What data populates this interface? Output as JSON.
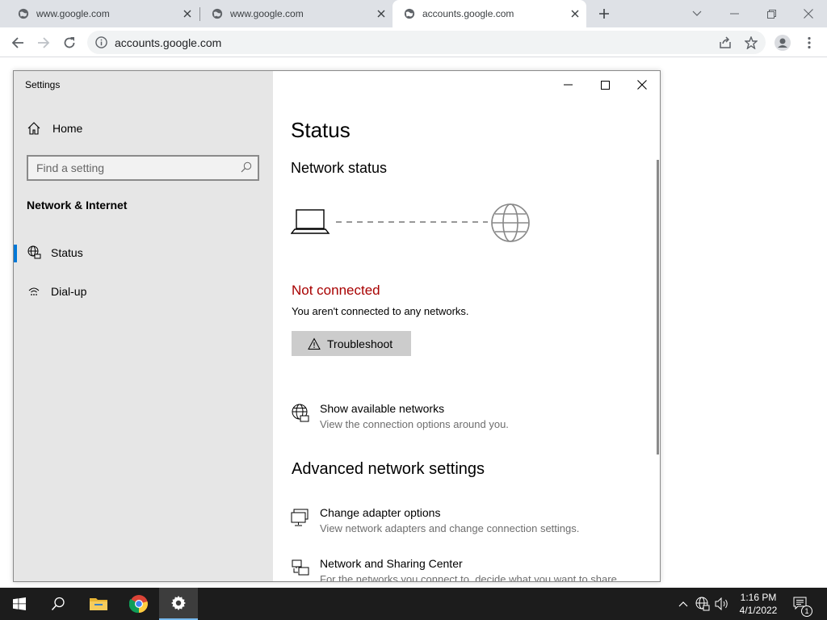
{
  "browser": {
    "tabs": [
      {
        "title": "www.google.com"
      },
      {
        "title": "www.google.com"
      },
      {
        "title": "accounts.google.com"
      }
    ],
    "url": "accounts.google.com"
  },
  "settings": {
    "window_title": "Settings",
    "home_label": "Home",
    "search_placeholder": "Find a setting",
    "section_heading": "Network & Internet",
    "nav": [
      {
        "label": "Status",
        "icon": "globe-status-icon"
      },
      {
        "label": "Dial-up",
        "icon": "dialup-icon"
      }
    ],
    "page_title": "Status",
    "network_status_title": "Network status",
    "status_text": "Not connected",
    "status_color": "#a80000",
    "status_desc": "You aren't connected to any networks.",
    "troubleshoot_label": "Troubleshoot",
    "show_networks": {
      "title": "Show available networks",
      "desc": "View the connection options around you."
    },
    "advanced_title": "Advanced network settings",
    "adapter": {
      "title": "Change adapter options",
      "desc": "View network adapters and change connection settings."
    },
    "sharing": {
      "title": "Network and Sharing Center",
      "desc": "For the networks you connect to, decide what you want to share."
    }
  },
  "taskbar": {
    "time": "1:16 PM",
    "date": "4/1/2022",
    "notification_count": "1",
    "accent": "#76b9ed"
  }
}
